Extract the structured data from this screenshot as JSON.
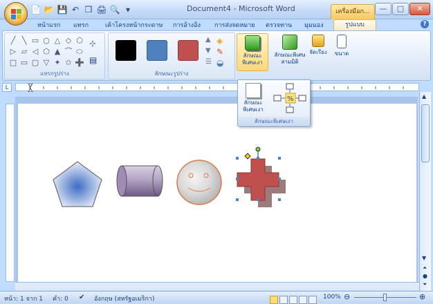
{
  "window": {
    "title": "Document4 - Microsoft Word",
    "context_tab_title": "เครื่องมือก...",
    "minimize": "—",
    "maximize": "□",
    "close": "✕"
  },
  "qat": [
    "📄",
    "📂",
    "💾",
    "↶",
    "❒",
    "🖨",
    "🔍",
    "▾"
  ],
  "tabs": [
    "หน้าแรก",
    "แทรก",
    "เค้าโครงหน้ากระดาษ",
    "การอ้างอิง",
    "การส่งจดหมาย",
    "ตรวจทาน",
    "มุมมอง",
    "รูปแบบ"
  ],
  "help": "?",
  "ribbon": {
    "group_insert_shapes": "แทรกรูปร่าง",
    "group_shape_styles": "ลักษณะรูปร่าง",
    "shapes": [
      "╱",
      "╲",
      "▭",
      "○",
      "△",
      "◇",
      "⬡",
      "▷",
      "▱",
      "◁",
      "⬠",
      "▲",
      "⌒",
      "⬭",
      "□",
      "▭",
      "▢",
      "▽",
      "✦",
      "✩",
      "➕"
    ],
    "swatch_colors": [
      "#000000",
      "#4f81bd",
      "#c0504d"
    ],
    "btn_shadow": "ลักษณะ\nพิเศษเงา",
    "btn_3d": "ลักษณะพิเศษ\nสามมิติ",
    "btn_arrange": "จัดเรียง",
    "btn_size": "ขนาด"
  },
  "popup": {
    "btn_shadow": "ลักษณะ\nพิเศษเงา",
    "group_label": "ลักษณะพิเศษเงา"
  },
  "ruler_tab_glyph": "L",
  "status": {
    "page": "หน้า: 1 จาก 1",
    "words": "คำ: 0",
    "language": "อังกฤษ (สหรัฐอเมริกา)",
    "zoom": "100%"
  }
}
